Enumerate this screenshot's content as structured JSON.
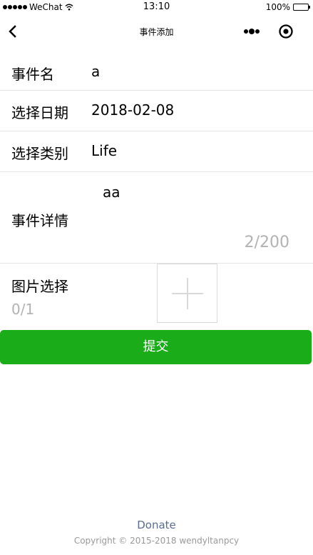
{
  "status_bar": {
    "carrier": "WeChat",
    "time": "13:10",
    "battery": "100%"
  },
  "nav": {
    "title": "事件添加",
    "icons": [
      "back-chevron-icon",
      "more-dots-icon",
      "close-circle-icon"
    ]
  },
  "form": {
    "name_label": "事件名",
    "name_value": "a",
    "date_label": "选择日期",
    "date_value": "2018-02-08",
    "type_label": "选择类别",
    "type_value": "Life",
    "detail_label": "事件详情",
    "detail_value": "aa",
    "detail_counter": "2/200",
    "image_label": "图片选择",
    "image_count": "0/1"
  },
  "submit_label": "提交",
  "footer": {
    "link": "Donate",
    "copyright": "Copyright © 2015-2018 wendyltanpcy"
  },
  "colors": {
    "primary": "#1aad19",
    "link": "#586c94",
    "muted": "#b2b2b2"
  }
}
